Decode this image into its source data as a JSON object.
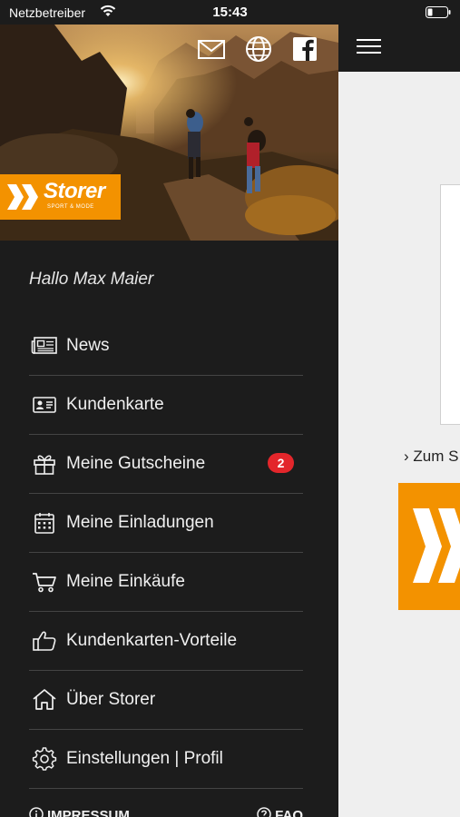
{
  "status_bar": {
    "carrier": "Netzbetreiber",
    "time": "15:43"
  },
  "main": {
    "link_text": "› Zum S"
  },
  "hero": {
    "brand_name": "Storer",
    "brand_tagline": "SPORT & MODE"
  },
  "greeting": "Hallo Max Maier",
  "menu": {
    "items": [
      {
        "label": "News",
        "icon": "newspaper-icon"
      },
      {
        "label": "Kundenkarte",
        "icon": "id-card-icon"
      },
      {
        "label": "Meine Gutscheine",
        "icon": "gift-icon",
        "badge": "2"
      },
      {
        "label": "Meine Einladungen",
        "icon": "calendar-icon"
      },
      {
        "label": "Meine Einkäufe",
        "icon": "shopping-cart-icon"
      },
      {
        "label": "Kundenkarten-Vorteile",
        "icon": "thumbs-up-icon"
      },
      {
        "label": "Über Storer",
        "icon": "home-icon"
      },
      {
        "label": "Einstellungen | Profil",
        "icon": "gear-icon"
      }
    ]
  },
  "footer": {
    "impressum": "IMPRESSUM",
    "faq": "FAQ"
  },
  "colors": {
    "drawer_bg": "#1c1c1c",
    "accent_orange": "#f39200",
    "badge_red": "#e3262b",
    "divider": "#444444"
  }
}
